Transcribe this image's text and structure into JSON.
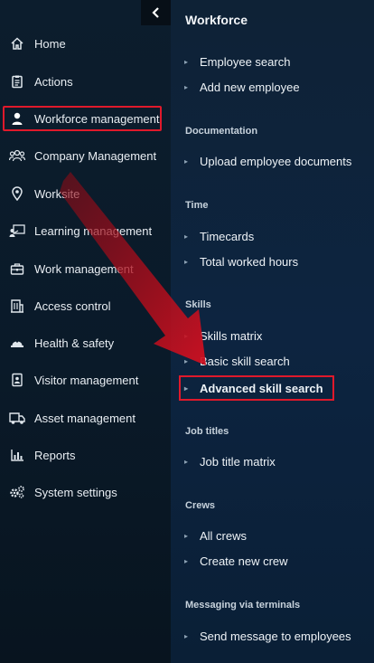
{
  "sidebar": {
    "collapse_icon": "chevron-left-icon",
    "items": [
      {
        "label": "Home",
        "icon": "home-icon"
      },
      {
        "label": "Actions",
        "icon": "clipboard-icon"
      },
      {
        "label": "Workforce management",
        "icon": "user-icon",
        "active": true
      },
      {
        "label": "Company Management",
        "icon": "users-icon"
      },
      {
        "label": "Worksite",
        "icon": "map-pin-icon"
      },
      {
        "label": "Learning management",
        "icon": "learning-icon"
      },
      {
        "label": "Work management",
        "icon": "toolbox-icon"
      },
      {
        "label": "Access control",
        "icon": "building-icon"
      },
      {
        "label": "Health & safety",
        "icon": "hard-hat-icon"
      },
      {
        "label": "Visitor management",
        "icon": "id-badge-icon"
      },
      {
        "label": "Asset management",
        "icon": "truck-icon"
      },
      {
        "label": "Reports",
        "icon": "bar-chart-icon"
      },
      {
        "label": "System settings",
        "icon": "gears-icon"
      }
    ]
  },
  "panel": {
    "title": "Workforce",
    "sections": [
      {
        "heading": "",
        "links": [
          "Employee search",
          "Add new employee"
        ]
      },
      {
        "heading": "Documentation",
        "links": [
          "Upload employee documents"
        ]
      },
      {
        "heading": "Time",
        "links": [
          "Timecards",
          "Total worked hours"
        ]
      },
      {
        "heading": "Skills",
        "links": [
          "Skills matrix",
          "Basic skill search",
          "Advanced skill search"
        ]
      },
      {
        "heading": "Job titles",
        "links": [
          "Job title matrix"
        ]
      },
      {
        "heading": "Crews",
        "links": [
          "All crews",
          "Create new crew"
        ]
      },
      {
        "heading": "Messaging via terminals",
        "links": [
          "Send message to employees"
        ]
      }
    ]
  },
  "colors": {
    "highlight": "#e0192b",
    "arrow": "#c4101e"
  }
}
